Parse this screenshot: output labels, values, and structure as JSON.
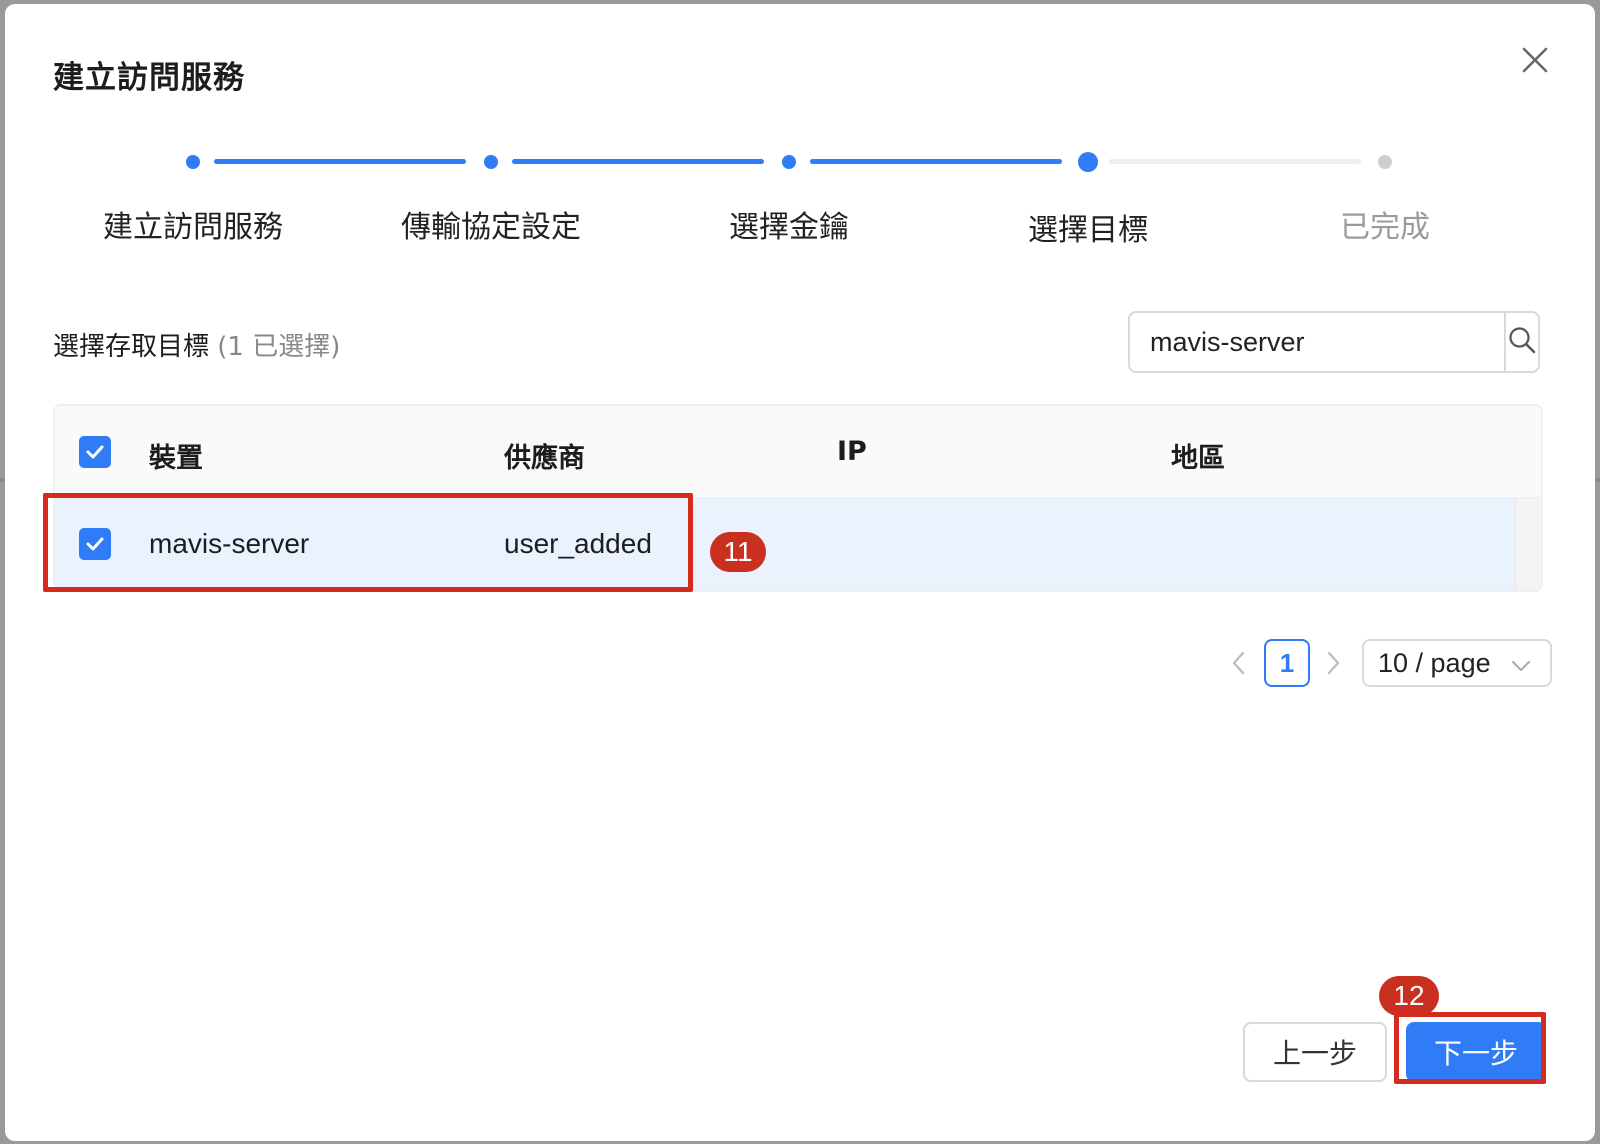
{
  "dialog": {
    "title": "建立訪問服務"
  },
  "steps": [
    {
      "label": "建立訪問服務",
      "state": "done"
    },
    {
      "label": "傳輸協定設定",
      "state": "done"
    },
    {
      "label": "選擇金鑰",
      "state": "done"
    },
    {
      "label": "選擇目標",
      "state": "active"
    },
    {
      "label": "已完成",
      "state": "pending"
    }
  ],
  "section": {
    "label": "選擇存取目標",
    "count": "(1 已選擇)"
  },
  "search": {
    "value": "mavis-server",
    "icon": "search-icon"
  },
  "table": {
    "columns": [
      "裝置",
      "供應商",
      "IP",
      "地區"
    ],
    "rows": [
      {
        "device": "mavis-server",
        "provider": "user_added",
        "ip": "",
        "region": "",
        "checked": true
      }
    ]
  },
  "pagination": {
    "current_page": "1",
    "page_size": "10 / page"
  },
  "annotations": {
    "row_marker": "11",
    "next_marker": "12"
  },
  "buttons": {
    "prev": "上一步",
    "next": "下一步"
  },
  "colors": {
    "primary": "#2f7cf6",
    "annotation": "#c9301f",
    "row_selected": "#e9f2fd"
  }
}
